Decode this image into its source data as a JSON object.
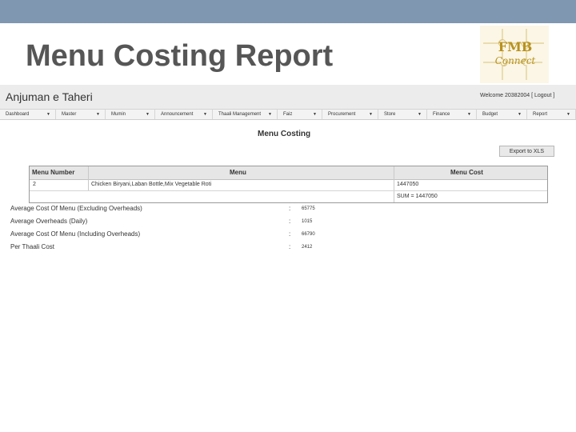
{
  "slide": {
    "title": "Menu Costing Report"
  },
  "logo": {
    "line1": "FMB",
    "line2": "Connect"
  },
  "app": {
    "brand": "Anjuman e Taheri",
    "welcome_text": "Welcome 20382004 [",
    "logout_label": "Logout",
    "welcome_close": "]"
  },
  "nav": [
    {
      "label": "Dashboard"
    },
    {
      "label": "Master"
    },
    {
      "label": "Mumin"
    },
    {
      "label": "Announcement"
    },
    {
      "label": "Thaali Management"
    },
    {
      "label": "Faiz"
    },
    {
      "label": "Procurement"
    },
    {
      "label": "Store"
    },
    {
      "label": "Finance"
    },
    {
      "label": "Budget"
    },
    {
      "label": "Report"
    }
  ],
  "report": {
    "heading": "Menu Costing",
    "export_label": "Export to XLS",
    "columns": [
      "Menu Number",
      "Menu",
      "Menu Cost"
    ],
    "rows": [
      {
        "number": "2",
        "menu": "Chicken Biryani,Laban Bottle,Mix Vegetable Roti",
        "cost": "1447050"
      }
    ],
    "sum": "SUM = 1447050"
  },
  "summary": [
    {
      "label": "Average Cost Of Menu (Excluding Overheads)",
      "sep": ":",
      "value": "65775"
    },
    {
      "label": "Average Overheads (Daily)",
      "sep": ":",
      "value": "1015"
    },
    {
      "label": "Average Cost Of Menu (Including Overheads)",
      "sep": ":",
      "value": "66790"
    },
    {
      "label": "Per Thaali Cost",
      "sep": ":",
      "value": "2412"
    }
  ],
  "colors": {
    "topbar": "#7f97b1",
    "title": "#565656",
    "logo_gold": "#c9a227"
  }
}
